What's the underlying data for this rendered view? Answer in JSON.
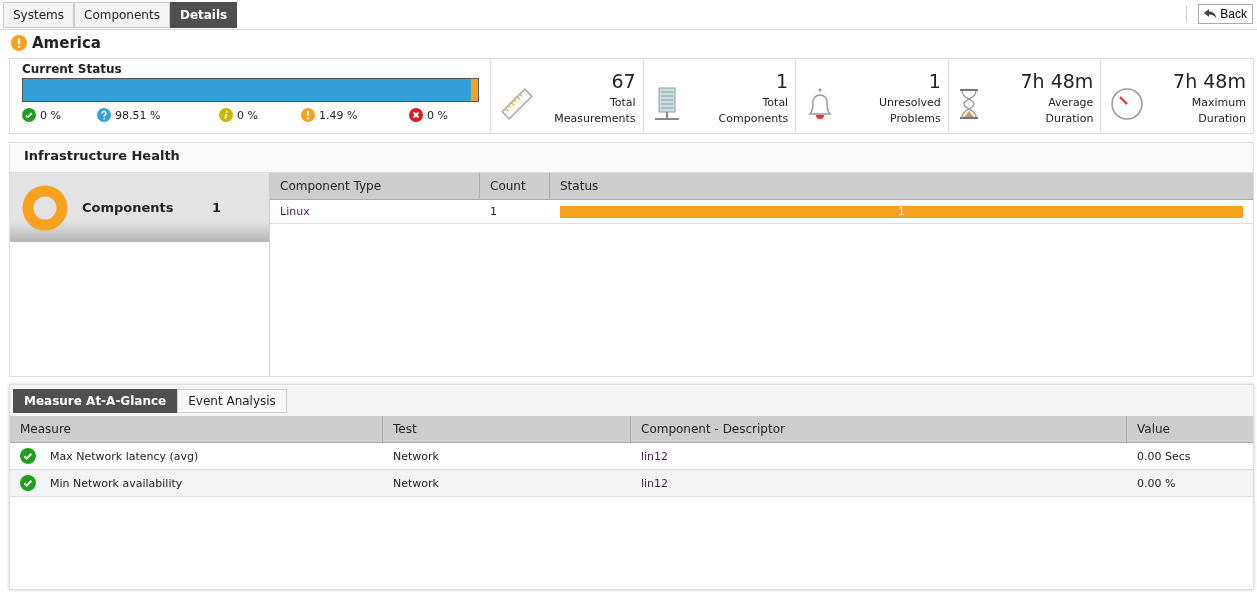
{
  "tabs": [
    {
      "label": "Systems",
      "selected": false
    },
    {
      "label": "Components",
      "selected": false
    },
    {
      "label": "Details",
      "selected": true
    }
  ],
  "back_button": {
    "label": "Back"
  },
  "zone": {
    "title": "America",
    "kind": "warning"
  },
  "current_status": {
    "title": "Current Status",
    "segments": [
      {
        "level": 0.9851,
        "color": "#33a1d8"
      },
      {
        "level": 0.0149,
        "color": "#f7a21e"
      }
    ],
    "legend": [
      {
        "kind": "ok",
        "value": "0 %"
      },
      {
        "kind": "unknown",
        "value": "98.51 %"
      },
      {
        "kind": "info",
        "value": "0 %"
      },
      {
        "kind": "warning",
        "value": "1.49 %"
      },
      {
        "kind": "critical",
        "value": "0 %"
      }
    ]
  },
  "stats": [
    {
      "kind": "ruler",
      "value": "67",
      "label": "Total Measurements"
    },
    {
      "kind": "server",
      "value": "1",
      "label": "Total Components"
    },
    {
      "kind": "bell",
      "value": "1",
      "label": "Unresolved Problems"
    },
    {
      "kind": "hourglass",
      "value": "7h 48m",
      "label": "Average Duration"
    },
    {
      "kind": "gauge",
      "value": "7h 48m",
      "label": "Maximum Duration"
    }
  ],
  "infrastructure": {
    "title": "Infrastructure Health",
    "summary": {
      "label": "Components",
      "count": "1",
      "color": "#f7a21e"
    },
    "columns": [
      "Component Type",
      "Count",
      "Status"
    ],
    "rows": [
      {
        "type": "Linux",
        "count": "1",
        "bar": {
          "label": "1",
          "level": 1,
          "color": "#f7a21e"
        }
      }
    ]
  },
  "measures": {
    "tabs": [
      {
        "label": "Measure At-A-Glance",
        "selected": true
      },
      {
        "label": "Event Analysis",
        "selected": false
      }
    ],
    "columns": [
      "Measure",
      "Test",
      "Component - Descriptor",
      "Value"
    ],
    "rows": [
      {
        "kind": "ok",
        "measure": "Max Network latency (avg)",
        "test": "Network",
        "component": "lin12",
        "value": "0.00 Secs"
      },
      {
        "kind": "ok",
        "measure": "Min Network availability",
        "test": "Network",
        "component": "lin12",
        "value": "0.00 %"
      }
    ]
  }
}
